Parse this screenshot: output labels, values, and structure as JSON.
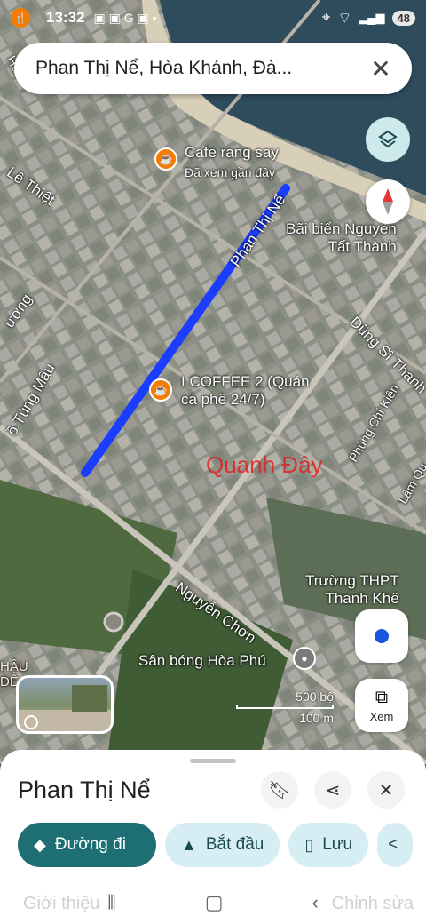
{
  "status": {
    "time": "13:32",
    "battery": "48"
  },
  "search": {
    "query": "Phan Thị Nể, Hòa Khánh, Đà...",
    "close_icon": "close-icon"
  },
  "map": {
    "street_labels": {
      "phan_thi_ne": "Phan Thị Nể",
      "le_thiet": "Lê Thiệt",
      "tung_mau": "ồ Tùng Mậu",
      "nguyen_chon": "Nguyễn Chơn",
      "dung_si_thanh": "Dũng Sĩ Thanh",
      "phung_chi_kien": "Phùng Chí Kiên",
      "lam_quang": "Lâm Qu",
      "ruong": "ương",
      "hau_de": "HẬU\nĐỀ"
    },
    "places": {
      "cafe_rang_say": "Cafe rang say",
      "cafe_rang_say_sub": "Đã xem gần đây",
      "beach": "Bãi biển Nguyễn\nTất Thành",
      "i_coffee": "I COFFEE 2 (Quán\ncà phê 24/7)",
      "school": "Trường THPT\nThanh Khê",
      "stadium": "Sân bóng Hòa Phú"
    },
    "watermark": "Quanh Đây",
    "scale": {
      "feet": "500 bộ",
      "meters": "100 m"
    },
    "xem_label": "Xem",
    "accent_route": "#1a3dff"
  },
  "sheet": {
    "title": "Phan Thị Nể",
    "actions": {
      "directions": "Đường đi",
      "start": "Bắt đầu",
      "save": "Lưu"
    },
    "tabs_faded": {
      "intro": "Giới thiệu",
      "edit": "Chỉnh sửa"
    }
  }
}
